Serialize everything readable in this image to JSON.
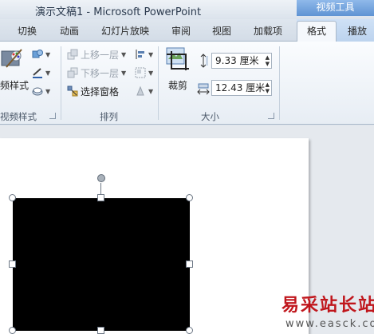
{
  "titlebar": {
    "title": "演示文稿1  -  Microsoft PowerPoint",
    "context_header": "视频工具"
  },
  "tabs": [
    {
      "label": "切换"
    },
    {
      "label": "动画"
    },
    {
      "label": "幻灯片放映"
    },
    {
      "label": "审阅"
    },
    {
      "label": "视图"
    },
    {
      "label": "加载项"
    },
    {
      "label": "格式",
      "active": true
    },
    {
      "label": "播放"
    }
  ],
  "ribbon": {
    "video_styles": {
      "button_label": "频样式",
      "group_label": "视频样式"
    },
    "arrange": {
      "bring_forward": "上移一层",
      "send_backward": "下移一层",
      "selection_pane": "选择窗格",
      "group_label": "排列"
    },
    "size": {
      "crop_label": "裁剪",
      "height": "9.33 厘米",
      "width": "12.43 厘米",
      "group_label": "大小"
    }
  },
  "watermark": {
    "site_name": "易采站长站",
    "url": "www.easck.com"
  },
  "colors": {
    "context_tab": "#5f93d3",
    "video_fill": "#000000",
    "watermark_red": "#c0161c"
  }
}
